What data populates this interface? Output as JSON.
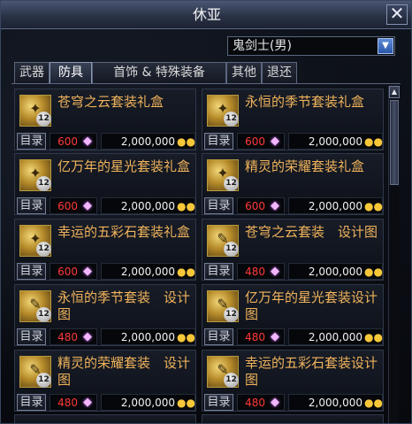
{
  "window": {
    "title": "休亚",
    "close_label": "✕"
  },
  "class_select": {
    "selected": "鬼剑士(男)",
    "arrow": "▼"
  },
  "tabs": [
    {
      "label": "武器",
      "active": false
    },
    {
      "label": "防具",
      "active": true
    },
    {
      "label": "首饰 & 特殊装备",
      "active": false
    },
    {
      "label": "其他",
      "active": false
    },
    {
      "label": "退还",
      "active": false
    }
  ],
  "items": [
    {
      "name": "苍穹之云套装礼盒",
      "catalog": "目录",
      "cost_a": "600",
      "cost_b": "2,000,000",
      "badge": "12",
      "icon": "gift-box-icon"
    },
    {
      "name": "永恒的季节套装礼盒",
      "catalog": "目录",
      "cost_a": "600",
      "cost_b": "2,000,000",
      "badge": "12",
      "icon": "gift-box-icon"
    },
    {
      "name": "亿万年的星光套装礼盒",
      "catalog": "目录",
      "cost_a": "600",
      "cost_b": "2,000,000",
      "badge": "12",
      "icon": "gift-box-icon"
    },
    {
      "name": "精灵的荣耀套装礼盒",
      "catalog": "目录",
      "cost_a": "600",
      "cost_b": "2,000,000",
      "badge": "12",
      "icon": "gift-box-icon"
    },
    {
      "name": "幸运的五彩石套装礼盒",
      "catalog": "目录",
      "cost_a": "600",
      "cost_b": "2,000,000",
      "badge": "12",
      "icon": "gift-box-icon"
    },
    {
      "name": "苍穹之云套装　设计图",
      "catalog": "目录",
      "cost_a": "480",
      "cost_b": "2,000,000",
      "badge": "12",
      "icon": "blueprint-icon"
    },
    {
      "name": "永恒的季节套装　设计图",
      "catalog": "目录",
      "cost_a": "480",
      "cost_b": "2,000,000",
      "badge": "12",
      "icon": "blueprint-icon"
    },
    {
      "name": "亿万年的星光套装设计图",
      "catalog": "目录",
      "cost_a": "480",
      "cost_b": "2,000,000",
      "badge": "12",
      "icon": "blueprint-icon"
    },
    {
      "name": "精灵的荣耀套装　设计图",
      "catalog": "目录",
      "cost_a": "480",
      "cost_b": "2,000,000",
      "badge": "12",
      "icon": "blueprint-icon"
    },
    {
      "name": "幸运的五彩石套装设计图",
      "catalog": "目录",
      "cost_a": "480",
      "cost_b": "2,000,000",
      "badge": "12",
      "icon": "blueprint-icon"
    }
  ],
  "colors": {
    "item_name": "#f0b35b",
    "cost_a": "#ff3838",
    "cost_b": "#f1f1f1"
  }
}
